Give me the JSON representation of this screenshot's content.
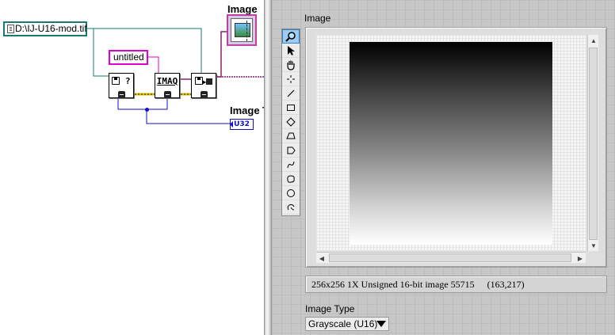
{
  "block_diagram": {
    "path_constant": "D:\\IJ-U16-mod.tif",
    "string_constant": "untitled",
    "image_indicator_label": "Image",
    "image_type_label": "Image T",
    "image_type_indicator": "U32",
    "nodes": {
      "file_info_question": "?",
      "imaq_create": "IMAQ"
    },
    "wire_colors": {
      "path": "#1a7a73",
      "string": "#e000d0",
      "image": "#8a2070",
      "error": "#b8a000",
      "numeric": "#1010c0"
    }
  },
  "front_panel": {
    "image_label": "Image",
    "status_text": "256x256 1X Unsigned 16-bit image 55715",
    "status_coords": "(163,217)",
    "image_type_label": "Image Type",
    "image_type_value": "Grayscale (U16)",
    "tools": [
      "zoom-icon",
      "pointer-icon",
      "pan-hand-icon",
      "point-crosshair-icon",
      "line-icon",
      "rectangle-icon",
      "rotated-rectangle-icon",
      "polygon-icon",
      "annulus-icon",
      "freehand-line-icon",
      "freehand-region-icon",
      "oval-icon",
      "broken-line-icon"
    ],
    "active_tool": "zoom-icon"
  }
}
